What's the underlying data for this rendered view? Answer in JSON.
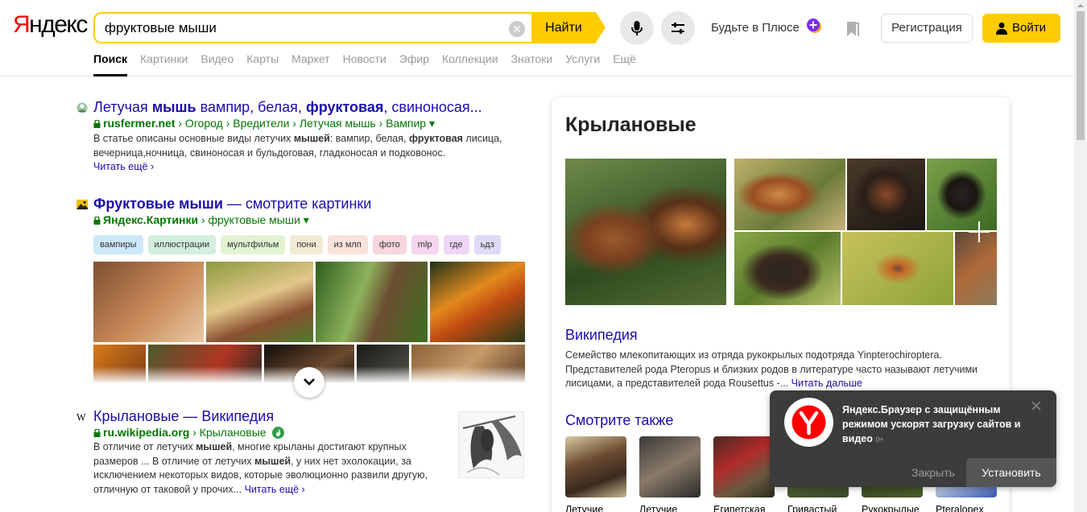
{
  "header": {
    "logo_first": "Я",
    "logo_rest": "ндекс",
    "search_value": "фруктовые мыши",
    "clear_symbol": "✕",
    "find_label": "Найти",
    "plus_label": "Будьте в Плюсе",
    "register_label": "Регистрация",
    "login_label": "Войти"
  },
  "nav": [
    "Поиск",
    "Картинки",
    "Видео",
    "Карты",
    "Маркет",
    "Новости",
    "Эфир",
    "Коллекции",
    "Знатоки",
    "Услуги",
    "Ещё"
  ],
  "results": [
    {
      "title_parts": [
        "Летучая ",
        "мышь",
        " вампир, белая, ",
        "фруктовая",
        ", свиноносая..."
      ],
      "url_host": "rusfermer.net",
      "url_path": " › Огород › Вредители › Летучая мышь › Вампир ▾",
      "snippet_parts": [
        "В статье описаны основные виды летучих ",
        "мышей",
        ": вампир, белая, ",
        "фруктовая",
        " лисица,",
        "вечерница,ночница, свиноносая и бульдоговая, гладконосая и подковонос."
      ],
      "more": "Читать ещё ›"
    },
    {
      "title_bold": "Фруктовые мыши",
      "title_rest": " — смотрите картинки",
      "url_host": "Яндекс.Картинки",
      "url_path": " › фруктовые мыши ▾"
    },
    {
      "title": "Крылановые — Википедия",
      "url_host": "ru.wikipedia.org",
      "url_path": " › Крылановые",
      "snippet_parts": [
        "В отличие от летучих ",
        "мышей",
        ", многие крыланы достигают крупных",
        "размеров ... В отличие от летучих ",
        "мышей",
        ", у них нет эхолокации, за",
        "исключением некоторых видов, которые эволюционно развили другую,",
        "отличную от таковой у прочих..."
      ],
      "more": "Читать ещё ›"
    }
  ],
  "chips": [
    {
      "label": "вампиры",
      "color": "#cde8f9"
    },
    {
      "label": "иллюстрации",
      "color": "#d3eedd"
    },
    {
      "label": "мультфильм",
      "color": "#e2f3d2"
    },
    {
      "label": "пони",
      "color": "#f1ead6"
    },
    {
      "label": "из млп",
      "color": "#f8e2da"
    },
    {
      "label": "фото",
      "color": "#f8d6dc"
    },
    {
      "label": "mlp",
      "color": "#f6d5ef"
    },
    {
      "label": "где",
      "color": "#eed6f6"
    },
    {
      "label": "ьдз",
      "color": "#e1d9f8"
    }
  ],
  "panel": {
    "title": "Крылановые",
    "wiki_label": "Википедия",
    "desc_lines": [
      "Семейство млекопитающих из отряда рукокрылых подотряда Yinpterochiroptera.",
      "Представителей рода Pteropus и близких родов в литературе часто называют летучими",
      "лисицами, а представителей рода Rousettus -... "
    ],
    "desc_more": "Читать дальше",
    "see_also_label": "Смотрите также",
    "see_also": [
      "Летучие",
      "Летучие",
      "Египетская",
      "Гривастый",
      "Рукокрылые",
      "Pteralopex"
    ]
  },
  "popup": {
    "text": "Яндекс.Браузер с защищённым режимом ускорят загрузку сайтов и видео",
    "age": "0+",
    "dismiss_label": "Закрыть",
    "install_label": "Установить"
  }
}
